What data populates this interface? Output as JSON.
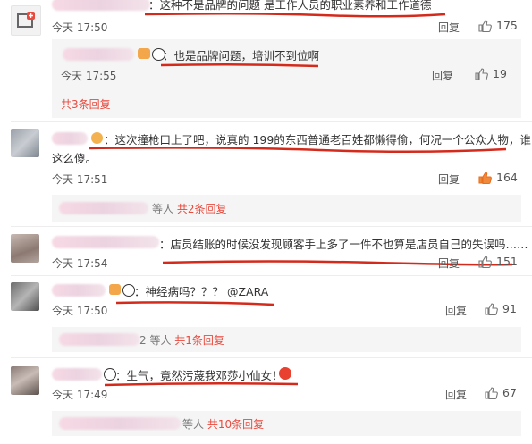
{
  "comments": [
    {
      "text": "：这种不是品牌的问题 是工作人员的职业素养和工作道德",
      "time": "今天 17:50",
      "reply": "回复",
      "likes": "175"
    },
    {
      "text": "：也是品牌问题，培训不到位啊",
      "time": "今天 17:55",
      "reply": "回复",
      "likes": "19"
    },
    {
      "text": "：这次撞枪口上了吧，说真的 199的东西普通老百姓都懒得偷，何况一个公众人物，谁",
      "text2": "这么傻。",
      "time": "今天 17:51",
      "reply": "回复",
      "likes": "164"
    },
    {
      "text": "：店员结账的时候没发现顾客手上多了一件不也算是店员自己的失误吗……",
      "time": "今天 17:54",
      "reply": "回复",
      "likes": "151"
    },
    {
      "text": "：神经病吗？？？ @ZARA",
      "time": "今天 17:50",
      "reply": "回复",
      "likes": "91"
    },
    {
      "text": "：生气，竟然污蔑我邓莎小仙女！",
      "time": "今天 17:49",
      "reply": "回复",
      "likes": "67"
    }
  ],
  "more_links": [
    {
      "prefix": "",
      "link": "共3条回复"
    },
    {
      "prefix": "等人",
      "link": "共2条回复"
    },
    {
      "prefix": "2 等人",
      "link": "共1条回复"
    },
    {
      "prefix": "等人",
      "link": "共10条回复"
    }
  ],
  "colors": {
    "accent": "#e84a3e",
    "underline": "#d42a1c"
  }
}
